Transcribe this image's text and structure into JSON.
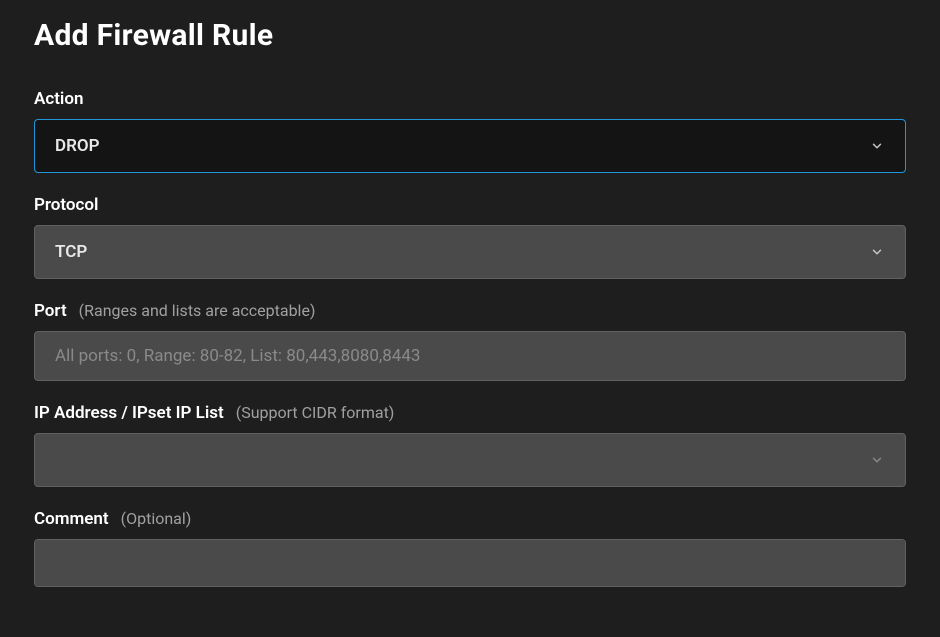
{
  "title": "Add Firewall Rule",
  "fields": {
    "action": {
      "label": "Action",
      "value": "DROP"
    },
    "protocol": {
      "label": "Protocol",
      "value": "TCP"
    },
    "port": {
      "label": "Port",
      "hint": "(Ranges and lists are acceptable)",
      "placeholder": "All ports: 0, Range: 80-82, List: 80,443,8080,8443",
      "value": ""
    },
    "ip": {
      "label": "IP Address / IPset IP List",
      "hint": "(Support CIDR format)",
      "value": ""
    },
    "comment": {
      "label": "Comment",
      "hint": "(Optional)",
      "value": ""
    }
  }
}
